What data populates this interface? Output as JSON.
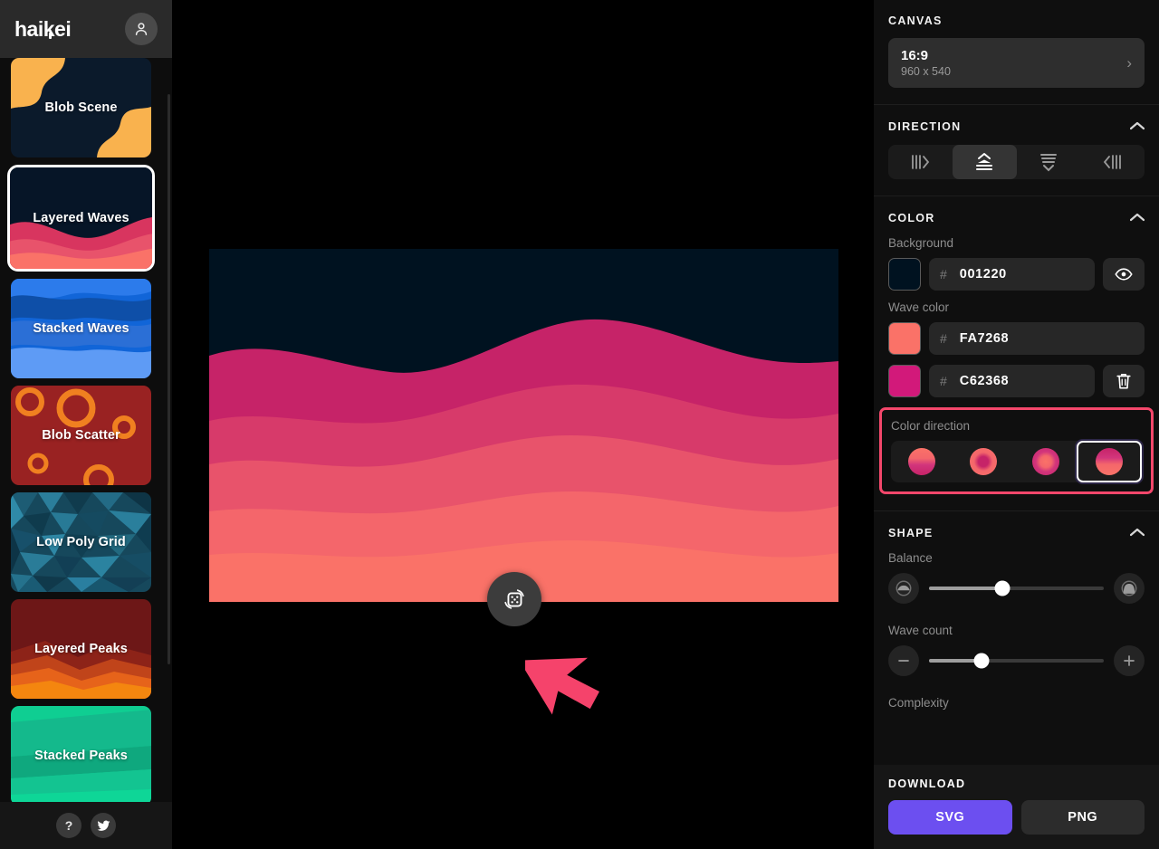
{
  "app": {
    "logo": "haikei",
    "logo_dot": ""
  },
  "sidebar": {
    "avatar_icon": "user-avatar-icon",
    "items": [
      {
        "label": "Blob Scene",
        "selected": false,
        "partial_top": false
      },
      {
        "label": "Layered Waves",
        "selected": true,
        "partial_top": false
      },
      {
        "label": "Stacked Waves",
        "selected": false,
        "partial_top": false
      },
      {
        "label": "Blob Scatter",
        "selected": false,
        "partial_top": false
      },
      {
        "label": "Low Poly Grid",
        "selected": false,
        "partial_top": false
      },
      {
        "label": "Layered Peaks",
        "selected": false,
        "partial_top": false
      },
      {
        "label": "Stacked Peaks",
        "selected": false,
        "partial_top": false
      }
    ],
    "footer": {
      "help_label": "?",
      "twitter_icon": "twitter-icon"
    }
  },
  "canvas_preview": {
    "background": "#001220",
    "wave_colors": [
      "#C62368",
      "#D73A6A",
      "#E8536B",
      "#F4666B",
      "#FA7268"
    ],
    "randomize_icon": "dice-shuffle-icon"
  },
  "panel": {
    "canvas": {
      "title": "CANVAS",
      "ratio": "16:9",
      "dimensions": "960 x 540",
      "arrow_icon": "chevron-right-icon"
    },
    "direction": {
      "title": "DIRECTION",
      "collapse_icon": "chevron-up-icon",
      "options": [
        {
          "name": "direction-right",
          "active": false
        },
        {
          "name": "direction-up",
          "active": true
        },
        {
          "name": "direction-down",
          "active": false
        },
        {
          "name": "direction-left",
          "active": false
        }
      ]
    },
    "color": {
      "title": "COLOR",
      "collapse_icon": "chevron-up-icon",
      "background_label": "Background",
      "background_hex": "001220",
      "background_swatch": "#001220",
      "hash": "#",
      "eye_icon": "eye-icon",
      "wave_label": "Wave color",
      "waves": [
        {
          "hex": "FA7268",
          "swatch": "#FA7268",
          "action": "none"
        },
        {
          "hex": "C62368",
          "swatch": "#D2197A",
          "action": "delete"
        }
      ],
      "trash_icon": "trash-icon",
      "color_direction_label": "Color direction",
      "color_direction_options": [
        {
          "name": "gradient-linear-down",
          "selected": false
        },
        {
          "name": "gradient-radial-in",
          "selected": false
        },
        {
          "name": "gradient-radial-out",
          "selected": false
        },
        {
          "name": "gradient-linear-up",
          "selected": true
        }
      ],
      "highlight_color": "#f4476b"
    },
    "shape": {
      "title": "SHAPE",
      "collapse_icon": "chevron-up-icon",
      "balance_label": "Balance",
      "balance_value": 42,
      "balance_left_icon": "balance-low-icon",
      "balance_right_icon": "balance-high-icon",
      "wave_count_label": "Wave count",
      "wave_count_value": 30,
      "wave_minus_icon": "minus-icon",
      "wave_plus_icon": "plus-icon",
      "complexity_label": "Complexity"
    },
    "download": {
      "title": "DOWNLOAD",
      "svg_label": "SVG",
      "png_label": "PNG",
      "svg_color": "#6c4ff0"
    }
  }
}
